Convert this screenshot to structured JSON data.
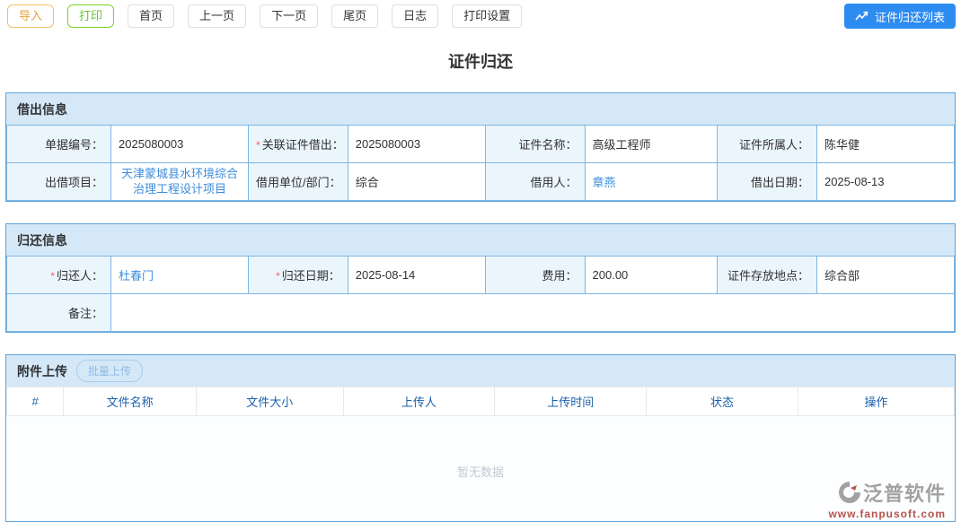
{
  "ui": {
    "required_mark": "*"
  },
  "colors": {
    "primary_button": "#2d8cf0",
    "panel_border": "#5da3dc",
    "section_header_bg": "#d5e8f7",
    "label_cell_bg": "#ebf5fc",
    "link": "#3c8ddc",
    "import_orange": "#e6a23c",
    "print_green": "#67c23a",
    "required_red": "#f25f5f",
    "table_header_text": "#1a5fae",
    "empty_text_gray": "#c3c9d4"
  },
  "toolbar": {
    "buttons": [
      {
        "label": "导入"
      },
      {
        "label": "打印"
      },
      {
        "label": "首页"
      },
      {
        "label": "上一页"
      },
      {
        "label": "下一页"
      },
      {
        "label": "尾页"
      },
      {
        "label": "日志"
      },
      {
        "label": "打印设置"
      }
    ],
    "list_button": {
      "label": "证件归还列表",
      "icon": "trending-up-icon"
    }
  },
  "page_title": "证件归还",
  "lend_section": {
    "title": "借出信息",
    "fields": {
      "doc_no": {
        "label": "单据编号：",
        "value": "2025080003"
      },
      "related": {
        "label": "关联证件借出：",
        "value": "2025080003",
        "required": true
      },
      "cert_name": {
        "label": "证件名称：",
        "value": "高级工程师"
      },
      "cert_owner": {
        "label": "证件所属人：",
        "value": "陈华健"
      },
      "project": {
        "label": "出借项目：",
        "value": "天津蒙城县水环境综合治理工程设计项目",
        "link": true
      },
      "borrow_dept": {
        "label": "借用单位/部门：",
        "value": "综合"
      },
      "borrower": {
        "label": "借用人：",
        "value": "章燕",
        "link": true
      },
      "lend_date": {
        "label": "借出日期：",
        "value": "2025-08-13"
      }
    }
  },
  "return_section": {
    "title": "归还信息",
    "fields": {
      "returner": {
        "label": "归还人：",
        "value": "杜春门",
        "required": true,
        "link": true
      },
      "return_date": {
        "label": "归还日期：",
        "value": "2025-08-14",
        "required": true
      },
      "fee": {
        "label": "费用：",
        "value": "200.00"
      },
      "location": {
        "label": "证件存放地点：",
        "value": "综合部"
      },
      "remark": {
        "label": "备注：",
        "value": ""
      }
    }
  },
  "attachments": {
    "title": "附件上传",
    "batch_upload_label": "批量上传",
    "columns": [
      "#",
      "文件名称",
      "文件大小",
      "上传人",
      "上传时间",
      "状态",
      "操作"
    ],
    "rows": [],
    "empty_text": "暂无数据"
  },
  "watermark": {
    "brand": "泛普软件",
    "url": "www.fanpusoft.com",
    "icon": "fanpu-logo-icon"
  }
}
